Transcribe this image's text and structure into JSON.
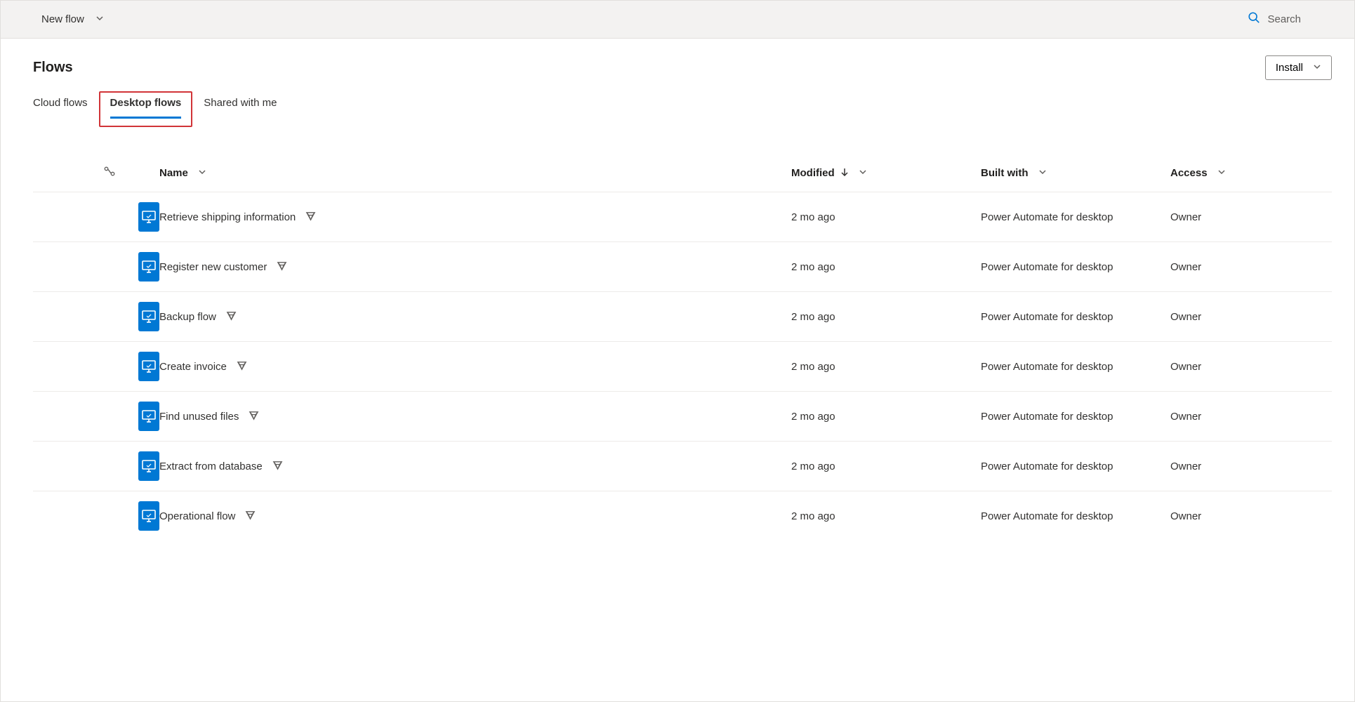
{
  "topbar": {
    "new_flow_label": "New flow",
    "search_placeholder": "Search"
  },
  "header": {
    "title": "Flows",
    "install_label": "Install"
  },
  "tabs": [
    {
      "label": "Cloud flows",
      "active": false
    },
    {
      "label": "Desktop flows",
      "active": true,
      "highlighted": true
    },
    {
      "label": "Shared with me",
      "active": false
    }
  ],
  "columns": {
    "name": "Name",
    "modified": "Modified",
    "built_with": "Built with",
    "access": "Access"
  },
  "rows": [
    {
      "name": "Retrieve shipping information",
      "modified": "2 mo ago",
      "built_with": "Power Automate for desktop",
      "access": "Owner"
    },
    {
      "name": "Register new customer",
      "modified": "2 mo ago",
      "built_with": "Power Automate for desktop",
      "access": "Owner"
    },
    {
      "name": "Backup flow",
      "modified": "2 mo ago",
      "built_with": "Power Automate for desktop",
      "access": "Owner"
    },
    {
      "name": "Create invoice",
      "modified": "2 mo ago",
      "built_with": "Power Automate for desktop",
      "access": "Owner"
    },
    {
      "name": "Find unused files",
      "modified": "2 mo ago",
      "built_with": "Power Automate for desktop",
      "access": "Owner"
    },
    {
      "name": "Extract from database",
      "modified": "2 mo ago",
      "built_with": "Power Automate for desktop",
      "access": "Owner"
    },
    {
      "name": "Operational flow",
      "modified": "2 mo ago",
      "built_with": "Power Automate for desktop",
      "access": "Owner"
    }
  ]
}
